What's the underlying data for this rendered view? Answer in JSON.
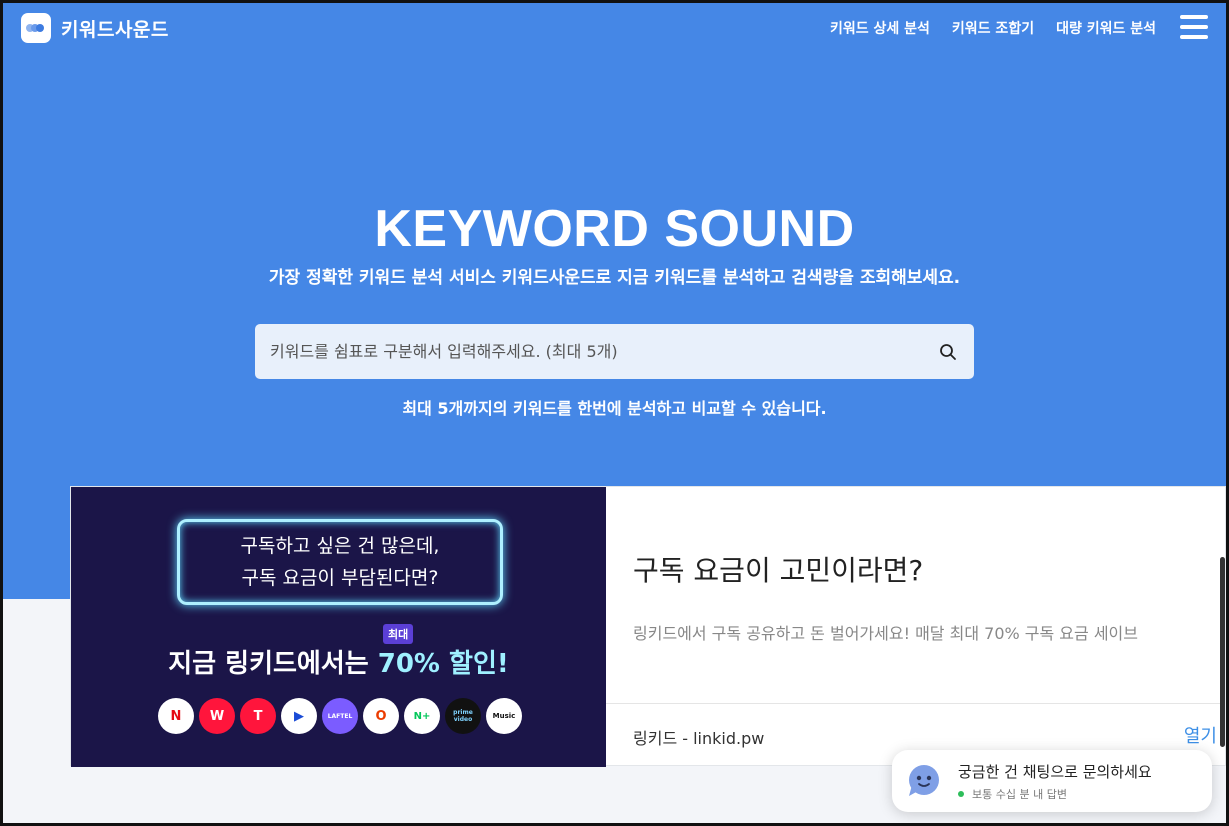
{
  "header": {
    "logo_text": "키워드사운드",
    "nav": [
      "키워드 상세 분석",
      "키워드 조합기",
      "대량 키워드 분석"
    ],
    "accent_color": "#4587e6",
    "menu_icon": "hamburger-icon"
  },
  "hero": {
    "title": "KEYWORD SOUND",
    "subtitle": "가장 정확한 키워드 분석 서비스 키워드사운드로 지금 키워드를 분석하고 검색량을 조회해보세요.",
    "search_placeholder": "키워드를 쉼표로 구분해서 입력해주세요. (최대 5개)",
    "search_icon": "search-icon",
    "note": "최대 5개까지의 키워드를 한번에 분석하고 비교할 수 있습니다."
  },
  "ad": {
    "image": {
      "neon_line1": "구독하고 싶은 건 많은데,",
      "neon_line2": "구독 요금이 부담된다면?",
      "badge": "최대",
      "headline_prefix": "지금 링키드에서는 ",
      "headline_highlight": "70% 할인!",
      "apps": [
        "N",
        "W",
        "T",
        "▶",
        "LAFTEL",
        "O",
        "N+",
        "prime video",
        "Music"
      ]
    },
    "title": "구독 요금이 고민이라면?",
    "description": "링키드에서 구독 공유하고 돈 벌어가세요! 매달 최대 70% 구독 요금 세이브",
    "source": "링키드 - linkid.pw",
    "open_label": "열기"
  },
  "chat": {
    "title": "궁금한 건 채팅으로 문의하세요",
    "status": "보통 수십 분 내 답변",
    "status_color": "#2dbd5a"
  }
}
